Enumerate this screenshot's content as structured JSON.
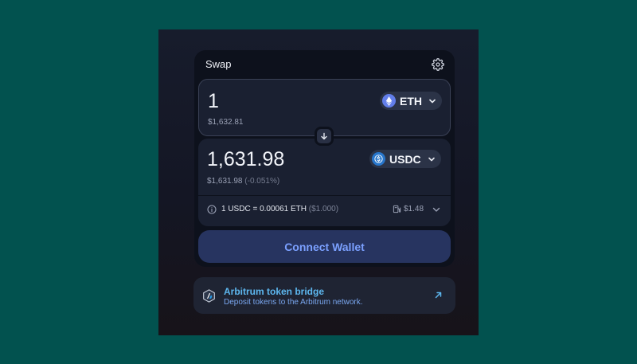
{
  "swap": {
    "title": "Swap",
    "settings_icon": "gear-icon"
  },
  "input": {
    "amount": "1",
    "usd_value": "$1,632.81",
    "token": {
      "symbol": "ETH",
      "icon": "eth-icon",
      "color": "#627eea"
    }
  },
  "switch": {
    "icon": "arrow-down-icon"
  },
  "output": {
    "amount": "1,631.98",
    "usd_value": "$1,631.98",
    "price_impact": "(-0.051%)",
    "token": {
      "symbol": "USDC",
      "icon": "usdc-icon",
      "color": "#2775ca"
    }
  },
  "rate": {
    "text": "1 USDC = 0.00061 ETH",
    "usd": "($1.000)",
    "gas": "$1.48",
    "info_icon": "info-icon",
    "gas_icon": "gas-pump-icon",
    "expand_icon": "chevron-down-icon"
  },
  "connect": {
    "label": "Connect Wallet"
  },
  "bridge": {
    "title": "Arbitrum token bridge",
    "subtitle": "Deposit tokens to the Arbitrum network.",
    "icon": "arbitrum-icon",
    "link_icon": "arrow-up-right-icon"
  },
  "colors": {
    "background": "#02524f",
    "accent": "#7ba0ff",
    "button": "#273460",
    "bridge_text": "#5db7ef"
  }
}
